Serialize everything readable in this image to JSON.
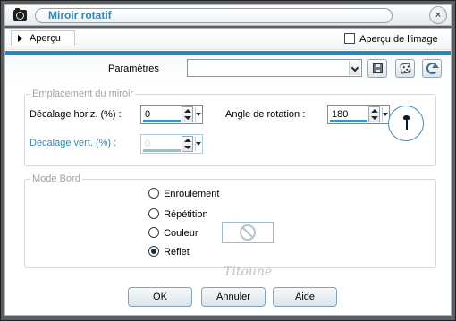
{
  "window": {
    "title": "Miroir rotatif",
    "close_symbol": "×"
  },
  "preview": {
    "toggle_label": "Aperçu",
    "checkbox_label": "Aperçu de l'image",
    "checkbox_checked": false
  },
  "presets": {
    "label": "Paramètres",
    "value": ""
  },
  "mirror_group": {
    "legend": "Emplacement du miroir",
    "horizontal_offset": {
      "label": "Décalage horiz. (%) :",
      "value": "0"
    },
    "vertical_offset": {
      "label": "Décalage vert. (%) :",
      "value": "0",
      "enabled": false
    },
    "rotation_angle": {
      "label": "Angle de rotation :",
      "value": "180"
    }
  },
  "edge_group": {
    "legend": "Mode Bord",
    "options": [
      {
        "label": "Enroulement",
        "selected": false
      },
      {
        "label": "Répétition",
        "selected": false
      },
      {
        "label": "Couleur",
        "selected": false
      },
      {
        "label": "Reflet",
        "selected": true
      }
    ]
  },
  "watermark": "Titoune",
  "buttons": {
    "ok": "OK",
    "cancel": "Annuler",
    "help": "Aide"
  },
  "icons": {
    "app": "camera-icon",
    "close": "close-icon",
    "save": "save-icon",
    "random": "dice-icon",
    "reset": "reset-icon",
    "no_color": "no-color-icon"
  },
  "colors": {
    "accent": "#2d86b5",
    "title_text": "#2f86b3",
    "disabled_label": "#2f8ab7"
  }
}
